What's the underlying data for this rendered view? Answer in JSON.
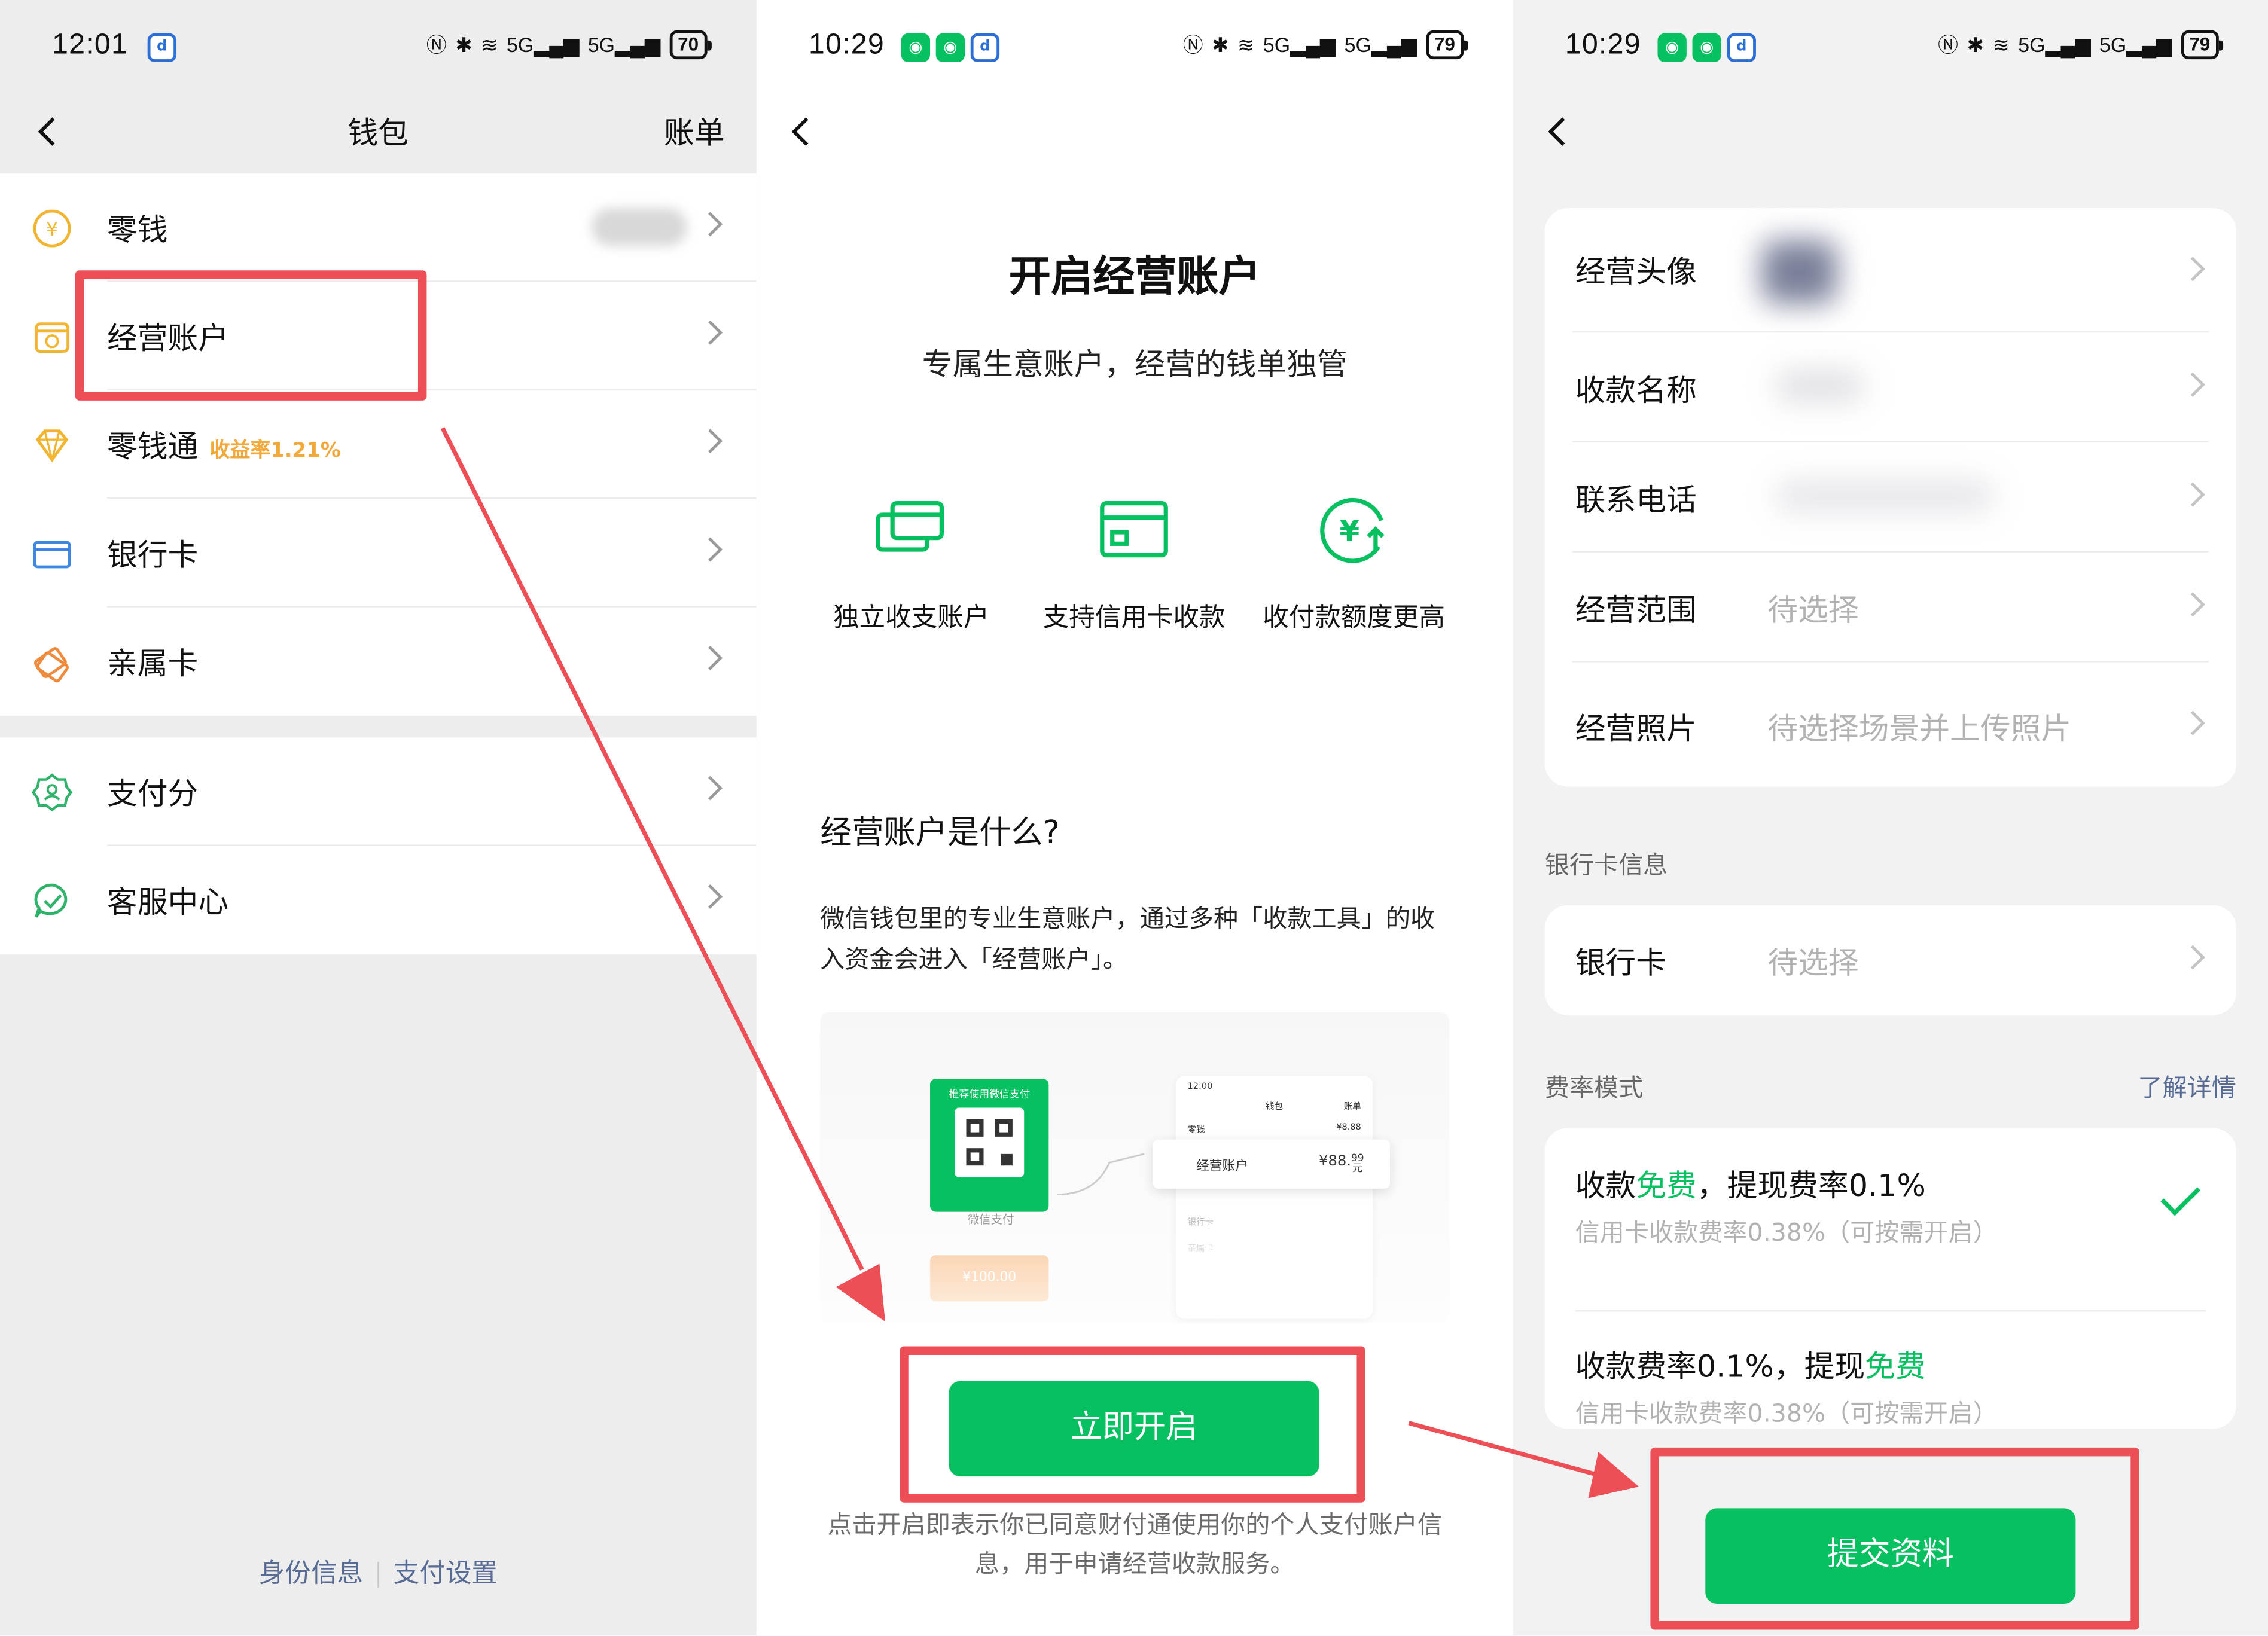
{
  "panel1": {
    "status": {
      "time": "12:01",
      "battery": "70"
    },
    "nav": {
      "title": "钱包",
      "right": "账单"
    },
    "items": [
      {
        "label": "零钱",
        "icon": "yuan-coin-icon"
      },
      {
        "label": "经营账户",
        "icon": "shop-account-icon"
      },
      {
        "label": "零钱通",
        "tag": "收益率1.21%",
        "icon": "diamond-icon"
      },
      {
        "label": "银行卡",
        "icon": "bank-card-icon"
      },
      {
        "label": "亲属卡",
        "icon": "family-card-icon"
      }
    ],
    "items2": [
      {
        "label": "支付分",
        "icon": "pay-score-icon"
      },
      {
        "label": "客服中心",
        "icon": "customer-service-icon"
      }
    ],
    "footer": {
      "identity": "身份信息",
      "settings": "支付设置"
    }
  },
  "panel2": {
    "status": {
      "time": "10:29",
      "battery": "79"
    },
    "title": "开启经营账户",
    "subtitle": "专属生意账户，经营的钱单独管",
    "features": [
      {
        "label": "独立收支账户",
        "icon": "cards-icon"
      },
      {
        "label": "支持信用卡收款",
        "icon": "credit-card-icon"
      },
      {
        "label": "收付款额度更高",
        "icon": "yuan-up-icon"
      }
    ],
    "what_title": "经营账户是什么?",
    "what_desc": "微信钱包里的专业生意账户，通过多种「收款工具」的收入资金会进入「经营账户」。",
    "illustration": {
      "qr_header": "推荐使用微信支付",
      "wechat_pay": "微信支付",
      "amount_chip": "¥100.00",
      "mini_time": "12:00",
      "mini_title": "钱包",
      "mini_right": "账单",
      "mini_row1": "零钱",
      "mini_row1_val": "¥8.88",
      "mini_highlight": "经营账户",
      "mini_highlight_val": "¥88.",
      "mini_highlight_frac": "99",
      "mini_highlight_frac2": "元",
      "mini_row3": "银行卡",
      "mini_row4": "亲属卡"
    },
    "button": "立即开启",
    "fine_print": "点击开启即表示你已同意财付通使用你的个人支付账户信息，用于申请经营收款服务。"
  },
  "panel3": {
    "status": {
      "time": "10:29",
      "battery": "79"
    },
    "fields": [
      {
        "label": "经营头像",
        "value": ""
      },
      {
        "label": "收款名称",
        "value": ""
      },
      {
        "label": "联系电话",
        "value": ""
      },
      {
        "label": "经营范围",
        "value": "待选择"
      },
      {
        "label": "经营照片",
        "value": "待选择场景并上传照片"
      }
    ],
    "bank_section": "银行卡信息",
    "bank": {
      "label": "银行卡",
      "value": "待选择"
    },
    "fee_section": "费率模式",
    "fee_link": "了解详情",
    "fee_options": [
      {
        "pre": "收款",
        "green": "免费",
        "post": "，提现费率0.1%",
        "sub": "信用卡收款费率0.38%（可按需开启）",
        "selected": true
      },
      {
        "pre": "收款费率0.1%，提现",
        "green": "免费",
        "post": "",
        "sub": "信用卡收款费率0.38%（可按需开启）",
        "selected": false
      }
    ],
    "button": "提交资料"
  },
  "colors": {
    "wechat_green": "#07c160",
    "highlight_red": "#ee4e55",
    "link_blue": "#576b95"
  }
}
